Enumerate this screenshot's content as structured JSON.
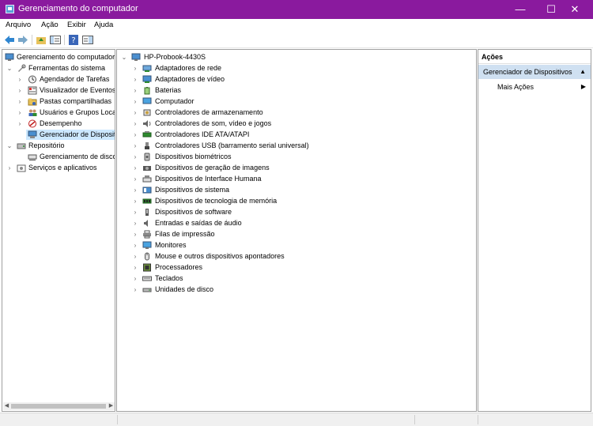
{
  "window": {
    "title": "Gerenciamento do computador",
    "minimize": "—",
    "maximize": "☐",
    "close": "✕"
  },
  "menu": [
    "Arquivo",
    "Ação",
    "Exibir",
    "Ajuda"
  ],
  "tree": {
    "root": "Gerenciamento do computador",
    "system_tools": "Ferramentas do sistema",
    "system_tools_items": [
      "Agendador de Tarefas",
      "Visualizador de Eventos",
      "Pastas compartilhadas",
      "Usuários e Grupos Loca",
      "Desempenho",
      "Gerenciador de Disposit"
    ],
    "storage": "Repositório",
    "storage_items": [
      "Gerenciamento de disco"
    ],
    "services": "Serviços e aplicativos"
  },
  "devices": {
    "computer": "HP-Probook-4430S",
    "categories": [
      "Adaptadores de rede",
      "Adaptadores de vídeo",
      "Baterias",
      "Computador",
      "Controladores de armazenamento",
      "Controladores de som, vídeo e jogos",
      "Controladores IDE ATA/ATAPI",
      "Controladores USB (barramento serial universal)",
      "Dispositivos biométricos",
      "Dispositivos de geração de imagens",
      "Dispositivos de Interface Humana",
      "Dispositivos de sistema",
      "Dispositivos de tecnologia de memória",
      "Dispositivos de software",
      "Entradas e saídas de áudio",
      "Filas de impressão",
      "Monitores",
      "Mouse e outros dispositivos apontadores",
      "Processadores",
      "Teclados",
      "Unidades de disco"
    ]
  },
  "actions": {
    "header": "Ações",
    "group": "Gerenciador de Dispositivos",
    "more": "Mais Ações"
  }
}
